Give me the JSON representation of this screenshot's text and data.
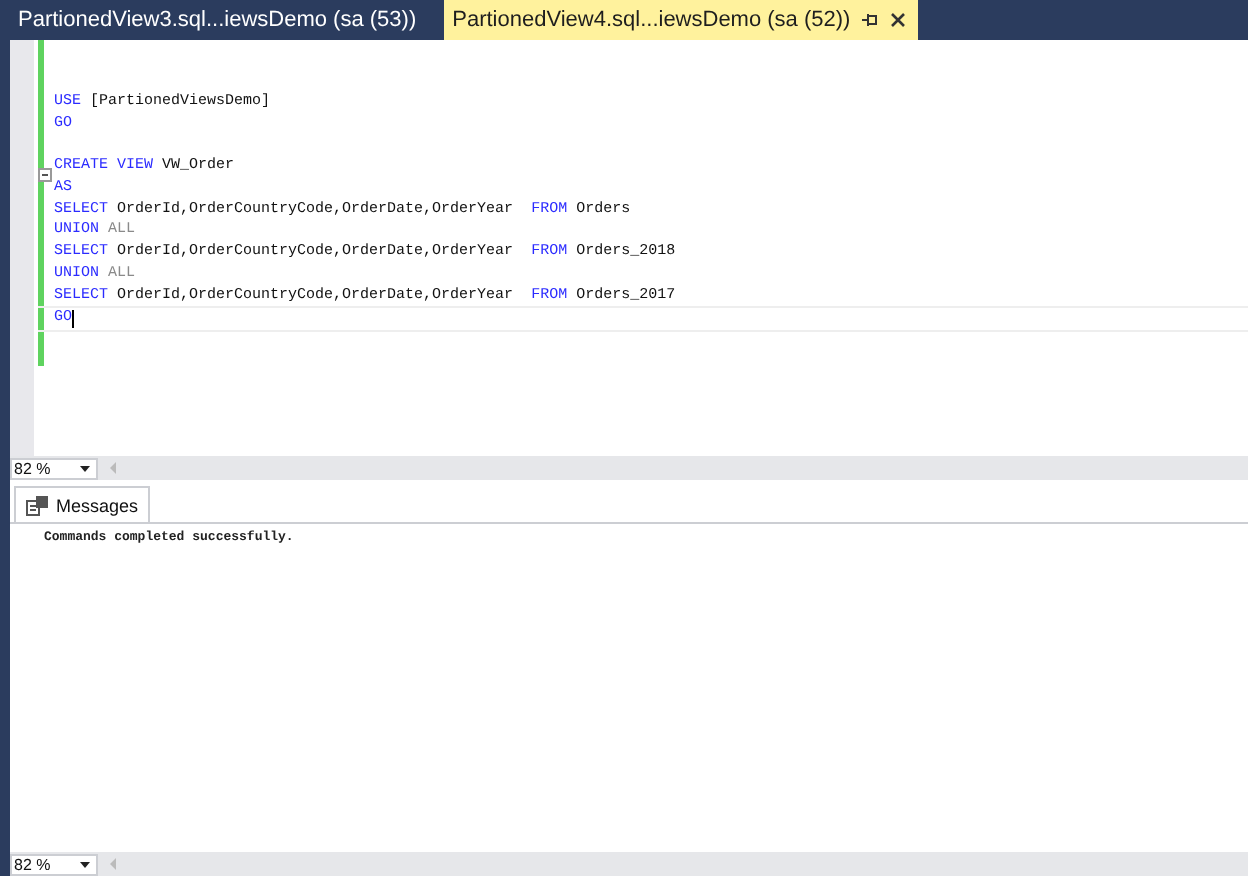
{
  "tabs": [
    {
      "label": "PartionedView3.sql...iewsDemo (sa (53))",
      "selected": false
    },
    {
      "label": "PartionedView4.sql...iewsDemo (sa (52))",
      "selected": true
    }
  ],
  "editor": {
    "lines": [
      {
        "gap_before": false,
        "collapsible": false,
        "current": false,
        "tokens": [
          {
            "text": "USE",
            "kind": "keyword"
          },
          {
            "text": " [PartionedViewsDemo]",
            "kind": "plain"
          }
        ]
      },
      {
        "gap_before": false,
        "collapsible": false,
        "current": false,
        "tokens": [
          {
            "text": "GO",
            "kind": "keyword"
          }
        ]
      },
      {
        "gap_before": true,
        "collapsible": true,
        "current": false,
        "tokens": [
          {
            "text": "CREATE VIEW",
            "kind": "keyword"
          },
          {
            "text": " VW_Order",
            "kind": "plain"
          }
        ]
      },
      {
        "gap_before": false,
        "collapsible": false,
        "current": false,
        "tokens": [
          {
            "text": "AS",
            "kind": "keyword"
          }
        ]
      },
      {
        "gap_before": false,
        "collapsible": false,
        "current": false,
        "tokens": [
          {
            "text": "SELECT",
            "kind": "keyword"
          },
          {
            "text": " OrderId,OrderCountryCode,OrderDate,OrderYear  ",
            "kind": "plain"
          },
          {
            "text": "FROM",
            "kind": "keyword"
          },
          {
            "text": " Orders",
            "kind": "plain"
          }
        ]
      },
      {
        "gap_before": false,
        "collapsible": false,
        "current": false,
        "tokens": [
          {
            "text": "UNION",
            "kind": "keyword"
          },
          {
            "text": " ALL",
            "kind": "operator"
          }
        ]
      },
      {
        "gap_before": false,
        "collapsible": false,
        "current": false,
        "tokens": [
          {
            "text": "SELECT",
            "kind": "keyword"
          },
          {
            "text": " OrderId,OrderCountryCode,OrderDate,OrderYear  ",
            "kind": "plain"
          },
          {
            "text": "FROM",
            "kind": "keyword"
          },
          {
            "text": " Orders_2018",
            "kind": "plain"
          }
        ]
      },
      {
        "gap_before": false,
        "collapsible": false,
        "current": false,
        "tokens": [
          {
            "text": "UNION",
            "kind": "keyword"
          },
          {
            "text": " ALL",
            "kind": "operator"
          }
        ]
      },
      {
        "gap_before": false,
        "collapsible": false,
        "current": false,
        "tokens": [
          {
            "text": "SELECT",
            "kind": "keyword"
          },
          {
            "text": " OrderId,OrderCountryCode,OrderDate,OrderYear  ",
            "kind": "plain"
          },
          {
            "text": "FROM",
            "kind": "keyword"
          },
          {
            "text": " Orders_2017",
            "kind": "plain"
          }
        ]
      },
      {
        "gap_before": false,
        "collapsible": false,
        "current": true,
        "tokens": [
          {
            "text": "GO",
            "kind": "keyword"
          }
        ]
      }
    ],
    "zoom": "82 %"
  },
  "results": {
    "tabs": [
      {
        "label": "Messages",
        "selected": true
      }
    ],
    "message": "Commands completed successfully.",
    "zoom": "82 %"
  }
}
